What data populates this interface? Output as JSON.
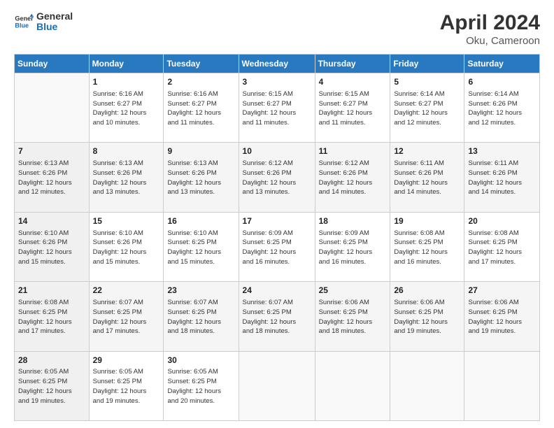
{
  "header": {
    "logo_line1": "General",
    "logo_line2": "Blue",
    "month_year": "April 2024",
    "location": "Oku, Cameroon"
  },
  "days_of_week": [
    "Sunday",
    "Monday",
    "Tuesday",
    "Wednesday",
    "Thursday",
    "Friday",
    "Saturday"
  ],
  "weeks": [
    [
      {
        "day": "",
        "info": ""
      },
      {
        "day": "1",
        "info": "Sunrise: 6:16 AM\nSunset: 6:27 PM\nDaylight: 12 hours\nand 10 minutes."
      },
      {
        "day": "2",
        "info": "Sunrise: 6:16 AM\nSunset: 6:27 PM\nDaylight: 12 hours\nand 11 minutes."
      },
      {
        "day": "3",
        "info": "Sunrise: 6:15 AM\nSunset: 6:27 PM\nDaylight: 12 hours\nand 11 minutes."
      },
      {
        "day": "4",
        "info": "Sunrise: 6:15 AM\nSunset: 6:27 PM\nDaylight: 12 hours\nand 11 minutes."
      },
      {
        "day": "5",
        "info": "Sunrise: 6:14 AM\nSunset: 6:27 PM\nDaylight: 12 hours\nand 12 minutes."
      },
      {
        "day": "6",
        "info": "Sunrise: 6:14 AM\nSunset: 6:26 PM\nDaylight: 12 hours\nand 12 minutes."
      }
    ],
    [
      {
        "day": "7",
        "info": "Sunrise: 6:13 AM\nSunset: 6:26 PM\nDaylight: 12 hours\nand 12 minutes."
      },
      {
        "day": "8",
        "info": "Sunrise: 6:13 AM\nSunset: 6:26 PM\nDaylight: 12 hours\nand 13 minutes."
      },
      {
        "day": "9",
        "info": "Sunrise: 6:13 AM\nSunset: 6:26 PM\nDaylight: 12 hours\nand 13 minutes."
      },
      {
        "day": "10",
        "info": "Sunrise: 6:12 AM\nSunset: 6:26 PM\nDaylight: 12 hours\nand 13 minutes."
      },
      {
        "day": "11",
        "info": "Sunrise: 6:12 AM\nSunset: 6:26 PM\nDaylight: 12 hours\nand 14 minutes."
      },
      {
        "day": "12",
        "info": "Sunrise: 6:11 AM\nSunset: 6:26 PM\nDaylight: 12 hours\nand 14 minutes."
      },
      {
        "day": "13",
        "info": "Sunrise: 6:11 AM\nSunset: 6:26 PM\nDaylight: 12 hours\nand 14 minutes."
      }
    ],
    [
      {
        "day": "14",
        "info": "Sunrise: 6:10 AM\nSunset: 6:26 PM\nDaylight: 12 hours\nand 15 minutes."
      },
      {
        "day": "15",
        "info": "Sunrise: 6:10 AM\nSunset: 6:26 PM\nDaylight: 12 hours\nand 15 minutes."
      },
      {
        "day": "16",
        "info": "Sunrise: 6:10 AM\nSunset: 6:25 PM\nDaylight: 12 hours\nand 15 minutes."
      },
      {
        "day": "17",
        "info": "Sunrise: 6:09 AM\nSunset: 6:25 PM\nDaylight: 12 hours\nand 16 minutes."
      },
      {
        "day": "18",
        "info": "Sunrise: 6:09 AM\nSunset: 6:25 PM\nDaylight: 12 hours\nand 16 minutes."
      },
      {
        "day": "19",
        "info": "Sunrise: 6:08 AM\nSunset: 6:25 PM\nDaylight: 12 hours\nand 16 minutes."
      },
      {
        "day": "20",
        "info": "Sunrise: 6:08 AM\nSunset: 6:25 PM\nDaylight: 12 hours\nand 17 minutes."
      }
    ],
    [
      {
        "day": "21",
        "info": "Sunrise: 6:08 AM\nSunset: 6:25 PM\nDaylight: 12 hours\nand 17 minutes."
      },
      {
        "day": "22",
        "info": "Sunrise: 6:07 AM\nSunset: 6:25 PM\nDaylight: 12 hours\nand 17 minutes."
      },
      {
        "day": "23",
        "info": "Sunrise: 6:07 AM\nSunset: 6:25 PM\nDaylight: 12 hours\nand 18 minutes."
      },
      {
        "day": "24",
        "info": "Sunrise: 6:07 AM\nSunset: 6:25 PM\nDaylight: 12 hours\nand 18 minutes."
      },
      {
        "day": "25",
        "info": "Sunrise: 6:06 AM\nSunset: 6:25 PM\nDaylight: 12 hours\nand 18 minutes."
      },
      {
        "day": "26",
        "info": "Sunrise: 6:06 AM\nSunset: 6:25 PM\nDaylight: 12 hours\nand 19 minutes."
      },
      {
        "day": "27",
        "info": "Sunrise: 6:06 AM\nSunset: 6:25 PM\nDaylight: 12 hours\nand 19 minutes."
      }
    ],
    [
      {
        "day": "28",
        "info": "Sunrise: 6:05 AM\nSunset: 6:25 PM\nDaylight: 12 hours\nand 19 minutes."
      },
      {
        "day": "29",
        "info": "Sunrise: 6:05 AM\nSunset: 6:25 PM\nDaylight: 12 hours\nand 19 minutes."
      },
      {
        "day": "30",
        "info": "Sunrise: 6:05 AM\nSunset: 6:25 PM\nDaylight: 12 hours\nand 20 minutes."
      },
      {
        "day": "",
        "info": ""
      },
      {
        "day": "",
        "info": ""
      },
      {
        "day": "",
        "info": ""
      },
      {
        "day": "",
        "info": ""
      }
    ]
  ]
}
